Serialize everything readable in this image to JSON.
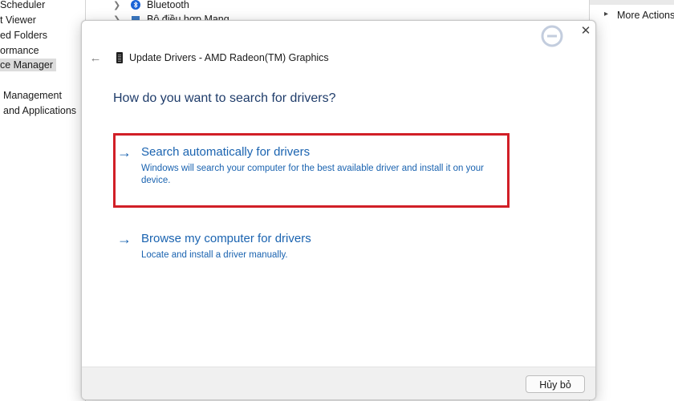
{
  "background": {
    "left_tree": [
      {
        "label": "Scheduler"
      },
      {
        "label": "t Viewer"
      },
      {
        "label": "ed Folders"
      },
      {
        "label": "ormance"
      },
      {
        "label": "ce Manager",
        "selected": true
      },
      {
        "label": "Management"
      },
      {
        "label": "and Applications"
      }
    ],
    "device_tree": [
      {
        "label": "Bluetooth",
        "icon": "bluetooth-icon"
      },
      {
        "label": "Bộ điều hợp Mạng",
        "icon": "network-adapter-icon"
      }
    ],
    "actions": {
      "label": "More Actions"
    }
  },
  "dialog": {
    "title": "Update Drivers - AMD Radeon(TM) Graphics",
    "heading": "How do you want to search for drivers?",
    "options": [
      {
        "title": "Search automatically for drivers",
        "description": "Windows will search your computer for the best available driver and install it on your device.",
        "highlighted": true
      },
      {
        "title": "Browse my computer for drivers",
        "description": "Locate and install a driver manually."
      }
    ],
    "cancel_label": "Hủy bỏ",
    "back_icon": "back-arrow-icon",
    "close_icon": "close-icon",
    "device_icon": "graphics-card-icon"
  },
  "colors": {
    "link_blue": "#1a63b0",
    "heading_blue": "#1f3c6a",
    "highlight_red": "#d11f27"
  }
}
